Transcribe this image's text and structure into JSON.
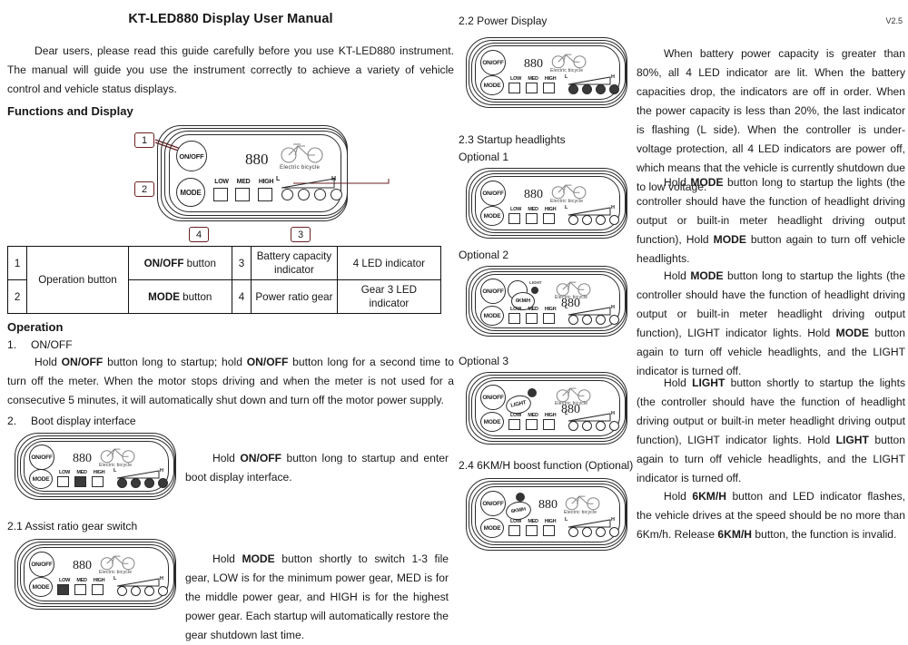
{
  "document": {
    "title": "KT-LED880 Display User Manual",
    "version": "V2.5",
    "intro": "Dear users, please read this guide carefully before you use KT-LED880 instrument. The manual will guide you use the instrument correctly to achieve a variety of vehicle control and vehicle status displays.",
    "functions_heading": "Functions and Display",
    "operation_heading": "Operation"
  },
  "device": {
    "brand_number": "880",
    "brand_text": "Electric bicycle",
    "onoff_label": "ON/OFF",
    "mode_label": "MODE",
    "light_label": "LIGHT",
    "boost_label": "6KM/H",
    "gear_low": "LOW",
    "gear_med": "MED",
    "gear_high": "HIGH",
    "scale_low": "L",
    "scale_high": "H"
  },
  "callouts": {
    "one": "1",
    "two": "2",
    "three": "3",
    "four": "4"
  },
  "spec_table": {
    "rows": [
      {
        "idx": "1",
        "group": "Operation button",
        "button": "ON/OFF button",
        "button_bold": "ON/OFF",
        "button_rest": " button",
        "idx2": "3",
        "capacity": "Battery capacity indicator",
        "led": "4 LED indicator"
      },
      {
        "idx": "2",
        "button_bold": "MODE",
        "button_rest": " button",
        "idx2": "4",
        "capacity": "Power ratio gear",
        "led": "Gear 3 LED indicator"
      }
    ]
  },
  "sections": {
    "op1": {
      "number": "1.",
      "title": "ON/OFF",
      "body_1": "Hold ",
      "body_b1": "ON/OFF",
      "body_2": " button long to startup; hold ",
      "body_b2": "ON/OFF",
      "body_3": " button long for a second time to turn off the meter. When the motor stops driving and when the meter is not used for a consecutive 5 minutes, it will automatically shut down and turn off the motor power supply."
    },
    "op2": {
      "number": "2.",
      "title": "Boot display interface",
      "body_1": "Hold ",
      "body_b1": "ON/OFF",
      "body_2": " button long to startup and enter boot display interface."
    },
    "s21": {
      "heading": "2.1   Assist ratio gear switch",
      "body_1": "Hold ",
      "body_b1": "MODE",
      "body_2": " button shortly to switch 1-3 file gear, LOW is for the minimum power gear, MED is for the middle power gear, and HIGH is for the highest power gear. Each startup will automatically restore the gear shutdown last time."
    },
    "s22": {
      "heading": "2.2 Power Display",
      "body_1": "When battery power capacity is greater than 80%, all 4 LED indicator are lit. When the battery capacities drop, the indicators are off in order. When the power capacity is less than 20%, the last indicator is flashing (L side). When the controller is under-voltage protection, all 4 LED indicators are power off, which means that the vehicle is currently shutdown due to low voltage."
    },
    "s23": {
      "heading": "2.3 Startup headlights",
      "opt1_label": "Optional 1",
      "opt1_1": "Hold ",
      "opt1_b1": "MODE",
      "opt1_2": " button long to startup the lights (the controller should have the function of headlight driving output or built-in meter headlight driving output function), Hold ",
      "opt1_b2": "MODE",
      "opt1_3": " button again to turn off vehicle headlights.",
      "opt2_label": "Optional 2",
      "opt2_1": "Hold ",
      "opt2_b1": "MODE",
      "opt2_2": " button long to startup the lights (the controller should have the function of headlight driving output or built-in meter headlight driving output function), LIGHT indicator lights. Hold ",
      "opt2_b2": "MODE",
      "opt2_3": " button again to turn off vehicle headlights, and the LIGHT indicator is turned off.",
      "opt3_label": "Optional 3",
      "opt3_1": "Hold ",
      "opt3_b1": "LIGHT",
      "opt3_2": " button shortly to startup the lights (the controller should have the function of headlight driving output or built-in meter headlight driving output function), LIGHT indicator lights. Hold ",
      "opt3_b2": "LIGHT",
      "opt3_3": " button again to turn off vehicle headlights, and the LIGHT indicator is turned off."
    },
    "s24": {
      "heading": "2.4 6KM/H boost function (Optional)",
      "body_1": "Hold ",
      "body_b1": "6KM/H",
      "body_2": " button and LED indicator flashes, the vehicle drives at the speed should be no more than 6Km/h. Release ",
      "body_b2": "6KM/H",
      "body_3": " button, the function is invalid."
    }
  },
  "colors": {
    "callout_border": "#6b1f22",
    "line_stroke": "#2b2b2b",
    "led_on": "#3a3a3a"
  }
}
